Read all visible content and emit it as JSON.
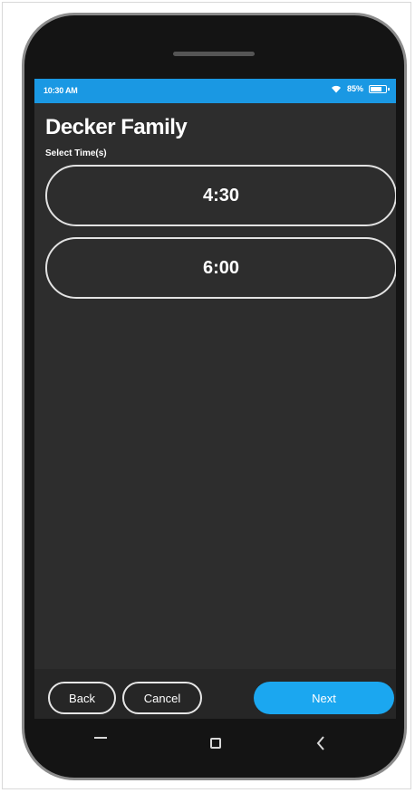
{
  "status_bar": {
    "time": "10:30 AM",
    "battery_text": "85%",
    "battery_level": 0.85,
    "bar_color": "#1a98e3"
  },
  "header": {
    "title": "Decker Family",
    "subtitle": "Select Time(s)"
  },
  "time_options": [
    {
      "label": "4:30"
    },
    {
      "label": "6:00"
    }
  ],
  "footer": {
    "back_label": "Back",
    "cancel_label": "Cancel",
    "next_label": "Next",
    "accent_color": "#1ba7f0"
  },
  "nav_icons": [
    "recents-icon",
    "home-icon",
    "back-icon"
  ]
}
